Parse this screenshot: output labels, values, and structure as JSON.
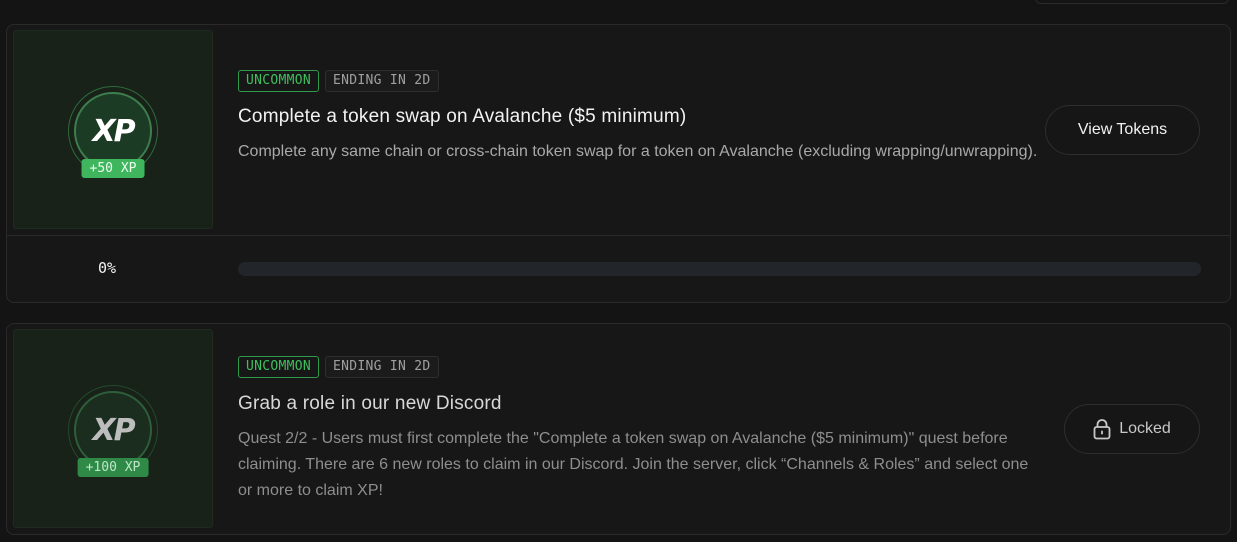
{
  "quests": [
    {
      "rarity": "UNCOMMON",
      "ending": "ENDING IN 2D",
      "title": "Complete a token swap on Avalanche ($5 minimum)",
      "description": "Complete any same chain or cross-chain token swap for a token on Avalanche (excluding wrapping/unwrapping).",
      "xp_logo": "XP",
      "xp_reward": "+50 XP",
      "action_label": "View Tokens",
      "progress_text": "0%",
      "progress_fraction": 0
    },
    {
      "rarity": "UNCOMMON",
      "ending": "ENDING IN 2D",
      "title": "Grab a role in our new Discord",
      "description": "Quest 2/2 - Users must first complete the \"Complete a token swap on Avalanche ($5 minimum)\" quest before claiming. There are 6 new roles to claim in our Discord. Join the server, click “Channels & Roles” and select one or more to claim XP!",
      "xp_logo": "XP",
      "xp_reward": "+100 XP",
      "action_label": "Locked",
      "action_icon": "lock-icon"
    }
  ],
  "colors": {
    "accent_green": "#3fb55d",
    "background": "#141414",
    "card": "#171717",
    "border": "#2a2a2a"
  }
}
